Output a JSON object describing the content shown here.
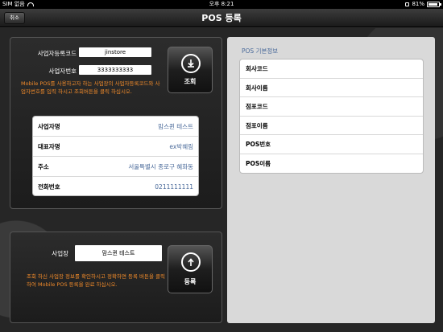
{
  "statusbar": {
    "carrier": "SIM 없음",
    "time": "오후 8:21",
    "battery": "81%"
  },
  "navbar": {
    "title": "POS 등록",
    "cancel_label": "취소"
  },
  "lookup": {
    "reg_code_label": "사업자등록코드",
    "reg_code_value": "jinstore",
    "biz_number_label": "사업자번호",
    "biz_number_value": "3333333333",
    "search_button": "조회",
    "notice": "Mobile POS를 사용하고자 하는 사업장의 사업자등록코드와 사업자번호를 입력 하시고 조회버튼을 클릭 하십시오."
  },
  "info": {
    "rows": [
      {
        "key": "사업자명",
        "value": "맘스퀸 테스트"
      },
      {
        "key": "대표자명",
        "value": "ex박혜림"
      },
      {
        "key": "주소",
        "value": "서울특별시 종로구 혜화동"
      },
      {
        "key": "전화번호",
        "value": "0211111111"
      }
    ]
  },
  "register": {
    "site_label": "사업장",
    "site_value": "맘스퀸 테스트",
    "register_button": "등록",
    "notice": "조회 하신 사업장 정보를 확인하시고 정확하면 등록 버튼을 클릭하여 Mobile POS 등록을 완료 하십시오."
  },
  "pos_info": {
    "title": "POS 기본정보",
    "rows": [
      "회사코드",
      "회사이름",
      "점포코드",
      "점포이름",
      "POS번호",
      "POS이름"
    ]
  },
  "colors": {
    "accent_text": "#4a6a9a",
    "notice_text": "#f08a2a"
  }
}
